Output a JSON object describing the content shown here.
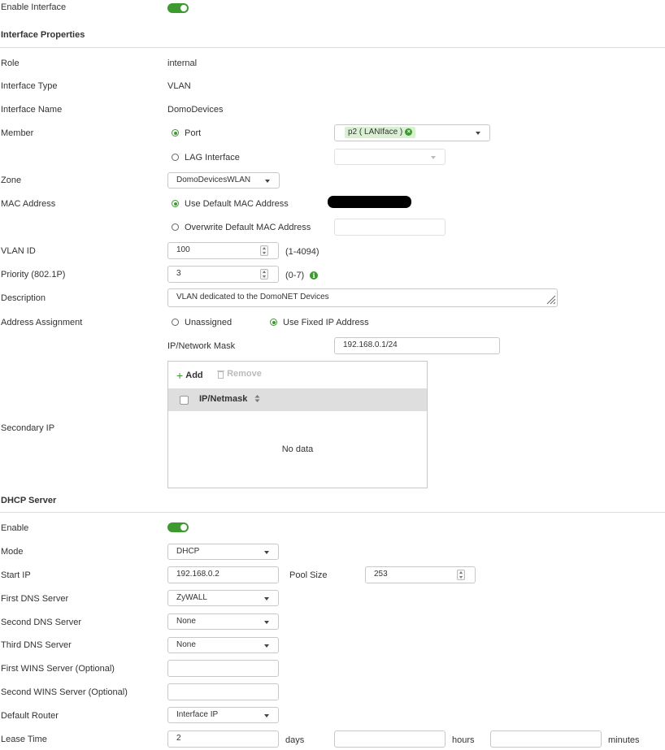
{
  "top": {
    "enable_interface_label": "Enable Interface",
    "enable_interface_on": true
  },
  "interface_properties": {
    "title": "Interface Properties",
    "role": {
      "label": "Role",
      "value": "internal"
    },
    "type": {
      "label": "Interface Type",
      "value": "VLAN"
    },
    "name": {
      "label": "Interface Name",
      "value": "DomoDevices"
    },
    "member": {
      "label": "Member",
      "port_label": "Port",
      "port_selected": true,
      "port_tag": "p2 ( LANIface )",
      "lag_label": "LAG Interface",
      "lag_selected": false,
      "lag_value": ""
    },
    "zone": {
      "label": "Zone",
      "value": "DomoDevicesWLAN"
    },
    "mac": {
      "label": "MAC Address",
      "default_label": "Use Default MAC Address",
      "default_selected": true,
      "overwrite_label": "Overwrite Default MAC Address",
      "overwrite_selected": false,
      "overwrite_value": ""
    },
    "vlan_id": {
      "label": "VLAN ID",
      "value": "100",
      "hint": "(1-4094)"
    },
    "priority": {
      "label": "Priority (802.1P)",
      "value": "3",
      "hint": "(0-7)",
      "info_icon": "info-icon"
    },
    "description": {
      "label": "Description",
      "value": "VLAN dedicated to the DomoNET Devices"
    },
    "address_assignment": {
      "label": "Address Assignment",
      "unassigned_label": "Unassigned",
      "unassigned_selected": false,
      "fixed_label": "Use Fixed IP Address",
      "fixed_selected": true
    },
    "ip_mask": {
      "label": "IP/Network Mask",
      "value": "192.168.0.1/24"
    },
    "secondary_ip": {
      "label": "Secondary IP",
      "add_label": "Add",
      "remove_label": "Remove",
      "column_header": "IP/Netmask",
      "empty_text": "No data"
    }
  },
  "dhcp": {
    "title": "DHCP Server",
    "enable": {
      "label": "Enable",
      "on": true
    },
    "mode": {
      "label": "Mode",
      "value": "DHCP"
    },
    "start_ip": {
      "label": "Start IP",
      "value": "192.168.0.2"
    },
    "pool_size": {
      "label": "Pool Size",
      "value": "253"
    },
    "dns1": {
      "label": "First DNS Server",
      "value": "ZyWALL"
    },
    "dns2": {
      "label": "Second DNS Server",
      "value": "None"
    },
    "dns3": {
      "label": "Third DNS Server",
      "value": "None"
    },
    "wins1": {
      "label": "First WINS Server (Optional)",
      "value": ""
    },
    "wins2": {
      "label": "Second WINS Server (Optional)",
      "value": ""
    },
    "router": {
      "label": "Default Router",
      "value": "Interface IP"
    },
    "lease": {
      "label": "Lease Time",
      "days": "2",
      "days_label": "days",
      "hours": "",
      "hours_label": "hours",
      "minutes": "",
      "minutes_label": "minutes"
    }
  },
  "colors": {
    "accent": "#3c9a2e",
    "tag_bg": "#d9f0d2",
    "table_header_bg": "#dedede",
    "divider": "#dcdcdc"
  }
}
